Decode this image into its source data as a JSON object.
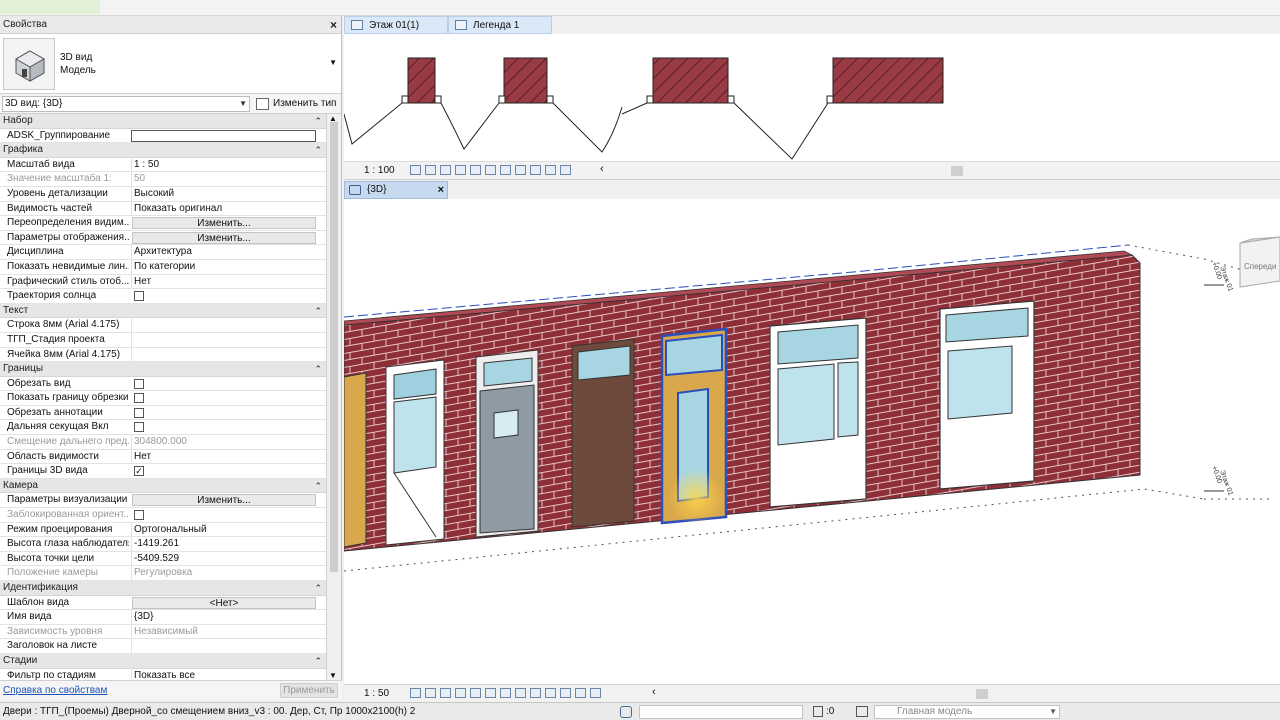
{
  "properties": {
    "title": "Свойства",
    "type_name": "3D вид",
    "type_sub": "Модель",
    "view_selector": "3D вид: {3D}",
    "edit_type": "Изменить тип",
    "groups": [
      {
        "name": "Набор",
        "rows": [
          {
            "label": "ADSK_Группирование",
            "kind": "textbox",
            "value": ""
          }
        ]
      },
      {
        "name": "Графика",
        "rows": [
          {
            "label": "Масштаб вида",
            "kind": "text",
            "value": "1 : 50"
          },
          {
            "label": "Значение масштаба    1:",
            "kind": "text",
            "value": "50",
            "disabled": true
          },
          {
            "label": "Уровень детализации",
            "kind": "text",
            "value": "Высокий"
          },
          {
            "label": "Видимость частей",
            "kind": "text",
            "value": "Показать оригинал"
          },
          {
            "label": "Переопределения видим...",
            "kind": "button",
            "value": "Изменить..."
          },
          {
            "label": "Параметры отображения...",
            "kind": "button",
            "value": "Изменить..."
          },
          {
            "label": "Дисциплина",
            "kind": "text",
            "value": "Архитектура"
          },
          {
            "label": "Показать невидимые лин...",
            "kind": "text",
            "value": "По категории"
          },
          {
            "label": "Графический стиль отоб...",
            "kind": "text",
            "value": "Нет"
          },
          {
            "label": "Траектория солнца",
            "kind": "check",
            "value": ""
          }
        ]
      },
      {
        "name": "Текст",
        "rows": [
          {
            "label": "Строка 8мм (Arial 4.175)",
            "kind": "text",
            "value": ""
          },
          {
            "label": "ТГП_Стадия проекта",
            "kind": "text",
            "value": ""
          },
          {
            "label": "Ячейка 8мм (Arial 4.175)",
            "kind": "text",
            "value": ""
          }
        ]
      },
      {
        "name": "Границы",
        "rows": [
          {
            "label": "Обрезать вид",
            "kind": "check",
            "value": ""
          },
          {
            "label": "Показать границу обрезки",
            "kind": "check",
            "value": ""
          },
          {
            "label": "Обрезать аннотации",
            "kind": "check",
            "value": ""
          },
          {
            "label": "Дальняя секущая Вкл",
            "kind": "check",
            "value": ""
          },
          {
            "label": "Смещение дальнего пред...",
            "kind": "text",
            "value": "304800.000",
            "disabled": true
          },
          {
            "label": "Область видимости",
            "kind": "text",
            "value": "Нет"
          },
          {
            "label": "Границы 3D вида",
            "kind": "check",
            "value": "✓"
          }
        ]
      },
      {
        "name": "Камера",
        "rows": [
          {
            "label": "Параметры визуализации",
            "kind": "button",
            "value": "Изменить..."
          },
          {
            "label": "Заблокированная ориент...",
            "kind": "check",
            "value": "",
            "disabled": true
          },
          {
            "label": "Режим проецирования",
            "kind": "text",
            "value": "Ортогональный"
          },
          {
            "label": "Высота глаза наблюдателя",
            "kind": "text",
            "value": "-1419.261"
          },
          {
            "label": "Высота точки цели",
            "kind": "text",
            "value": "-5409.529"
          },
          {
            "label": "Положение камеры",
            "kind": "text",
            "value": "Регулировка",
            "disabled": true
          }
        ]
      },
      {
        "name": "Идентификация",
        "rows": [
          {
            "label": "Шаблон вида",
            "kind": "button",
            "value": "<Нет>"
          },
          {
            "label": "Имя вида",
            "kind": "text",
            "value": "{3D}"
          },
          {
            "label": "Зависимость уровня",
            "kind": "text",
            "value": "Независимый",
            "disabled": true
          },
          {
            "label": "Заголовок на листе",
            "kind": "text",
            "value": ""
          }
        ]
      },
      {
        "name": "Стадии",
        "rows": [
          {
            "label": "Фильтр по стадиям",
            "kind": "text",
            "value": "Показать все"
          }
        ]
      }
    ],
    "help_link": "Справка по свойствам",
    "apply": "Применить"
  },
  "tabs": [
    {
      "label": "Этаж 01(1)"
    },
    {
      "label": "Легенда 1"
    }
  ],
  "top_view": {
    "scale": "1 : 100"
  },
  "view3d": {
    "tab_label": "{3D}",
    "scale": "1 : 50",
    "viewcube_label": "Спереди",
    "level_label": "Этаж 01",
    "level_value": "+0.00"
  },
  "status": {
    "text": "Двери : ТГП_(Проемы) Дверной_со смещением вниз_v3 : 00. Дер, Ст, Пр 1000х2100(h) 2",
    "filter_count": ":0",
    "model": "Главная модель"
  },
  "colors": {
    "brick": "#8e2f38",
    "mortar": "#e7c5c8",
    "accent_blue": "#2a4fbf",
    "tab_bg": "#dbe8f7"
  }
}
